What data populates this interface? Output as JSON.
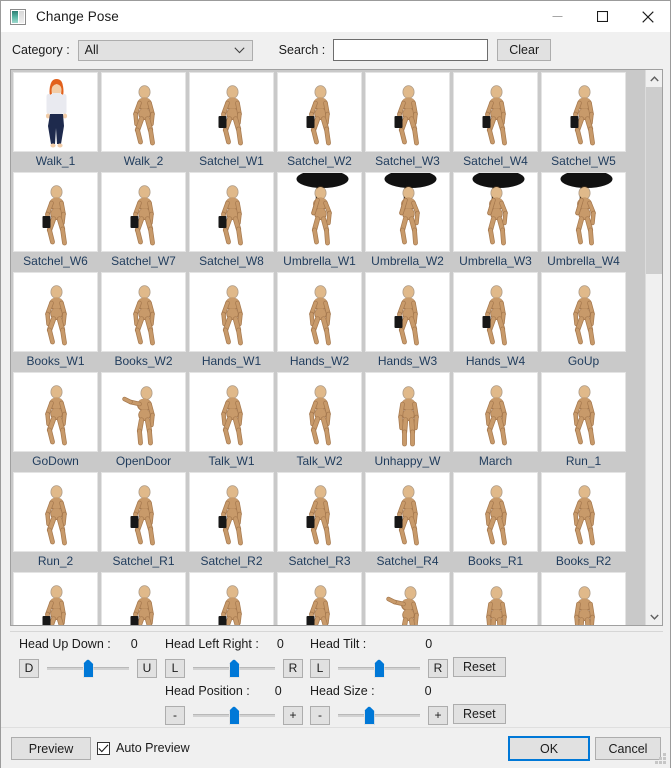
{
  "window": {
    "title": "Change Pose",
    "icon": "image-icon",
    "minimize_label": "—",
    "maximize_label": "□",
    "close_label": "✕"
  },
  "toolbar": {
    "category_label": "Category :",
    "category_value": "All",
    "category_options": [
      "All"
    ],
    "search_label": "Search :",
    "search_value": "",
    "search_placeholder": "",
    "clear_label": "Clear"
  },
  "grid": {
    "columns": 7,
    "items": [
      {
        "label": "Walk_1",
        "style": "girl",
        "selected": true
      },
      {
        "label": "Walk_2",
        "style": "walk",
        "selected": false
      },
      {
        "label": "Satchel_W1",
        "style": "satchel",
        "selected": false
      },
      {
        "label": "Satchel_W2",
        "style": "satchel",
        "selected": false
      },
      {
        "label": "Satchel_W3",
        "style": "satchel",
        "selected": false
      },
      {
        "label": "Satchel_W4",
        "style": "satchel",
        "selected": false
      },
      {
        "label": "Satchel_W5",
        "style": "satchel",
        "selected": false
      },
      {
        "label": "Satchel_W6",
        "style": "satchel",
        "selected": false
      },
      {
        "label": "Satchel_W7",
        "style": "satchel",
        "selected": false
      },
      {
        "label": "Satchel_W8",
        "style": "satchel",
        "selected": false
      },
      {
        "label": "Umbrella_W1",
        "style": "umbrella",
        "selected": false
      },
      {
        "label": "Umbrella_W2",
        "style": "umbrella",
        "selected": false
      },
      {
        "label": "Umbrella_W3",
        "style": "umbrella",
        "selected": false
      },
      {
        "label": "Umbrella_W4",
        "style": "umbrella",
        "selected": false
      },
      {
        "label": "Books_W1",
        "style": "walk",
        "selected": false
      },
      {
        "label": "Books_W2",
        "style": "walk",
        "selected": false
      },
      {
        "label": "Hands_W1",
        "style": "walk",
        "selected": false
      },
      {
        "label": "Hands_W2",
        "style": "walk",
        "selected": false
      },
      {
        "label": "Hands_W3",
        "style": "satchel",
        "selected": false
      },
      {
        "label": "Hands_W4",
        "style": "satchel",
        "selected": false
      },
      {
        "label": "GoUp",
        "style": "walk",
        "selected": false
      },
      {
        "label": "GoDown",
        "style": "walk",
        "selected": false
      },
      {
        "label": "OpenDoor",
        "style": "reach",
        "selected": false
      },
      {
        "label": "Talk_W1",
        "style": "walk",
        "selected": false
      },
      {
        "label": "Talk_W2",
        "style": "walk",
        "selected": false
      },
      {
        "label": "Unhappy_W",
        "style": "stand",
        "selected": false
      },
      {
        "label": "March",
        "style": "walk",
        "selected": false
      },
      {
        "label": "Run_1",
        "style": "walk",
        "selected": false
      },
      {
        "label": "Run_2",
        "style": "walk",
        "selected": false
      },
      {
        "label": "Satchel_R1",
        "style": "satchel",
        "selected": false
      },
      {
        "label": "Satchel_R2",
        "style": "satchel",
        "selected": false
      },
      {
        "label": "Satchel_R3",
        "style": "satchel",
        "selected": false
      },
      {
        "label": "Satchel_R4",
        "style": "satchel",
        "selected": false
      },
      {
        "label": "Books_R1",
        "style": "walk",
        "selected": false
      },
      {
        "label": "Books_R2",
        "style": "walk",
        "selected": false
      },
      {
        "label": "",
        "style": "satchel",
        "selected": false
      },
      {
        "label": "",
        "style": "satchel",
        "selected": false
      },
      {
        "label": "",
        "style": "satchel",
        "selected": false
      },
      {
        "label": "",
        "style": "satchel",
        "selected": false
      },
      {
        "label": "",
        "style": "reach",
        "selected": false
      },
      {
        "label": "",
        "style": "stand",
        "selected": false
      },
      {
        "label": "",
        "style": "stand",
        "selected": false
      }
    ]
  },
  "scrollbar": {
    "up_arrow": "chevron-up",
    "down_arrow": "chevron-down",
    "thumb_position_pct": 0,
    "thumb_size_pct": 36
  },
  "controls": {
    "head_up_down": {
      "caption": "Head Up Down :",
      "value": "0",
      "min_label": "D",
      "max_label": "U",
      "thumb_pct": 50
    },
    "head_left_right": {
      "caption": "Head Left Right :",
      "value": "0",
      "min_label": "L",
      "max_label": "R",
      "thumb_pct": 50
    },
    "head_tilt": {
      "caption": "Head Tilt :",
      "value": "0",
      "min_label": "L",
      "max_label": "R",
      "thumb_pct": 50
    },
    "head_position": {
      "caption": "Head Position :",
      "value": "0",
      "min_label": "-",
      "max_label": "+",
      "thumb_pct": 50
    },
    "head_size": {
      "caption": "Head Size :",
      "value": "0",
      "min_label": "-",
      "max_label": "+",
      "thumb_pct": 38
    },
    "reset_top_label": "Reset",
    "reset_bottom_label": "Reset"
  },
  "footer": {
    "preview_label": "Preview",
    "auto_preview_label": "Auto Preview",
    "auto_preview_checked": true,
    "ok_label": "OK",
    "cancel_label": "Cancel"
  },
  "colors": {
    "accent": "#0078d7",
    "dialog_bg": "#f0f0f0",
    "grid_bg": "#c9c9c9",
    "label_text": "#1f3b5c",
    "button_face": "#e1e1e1"
  }
}
